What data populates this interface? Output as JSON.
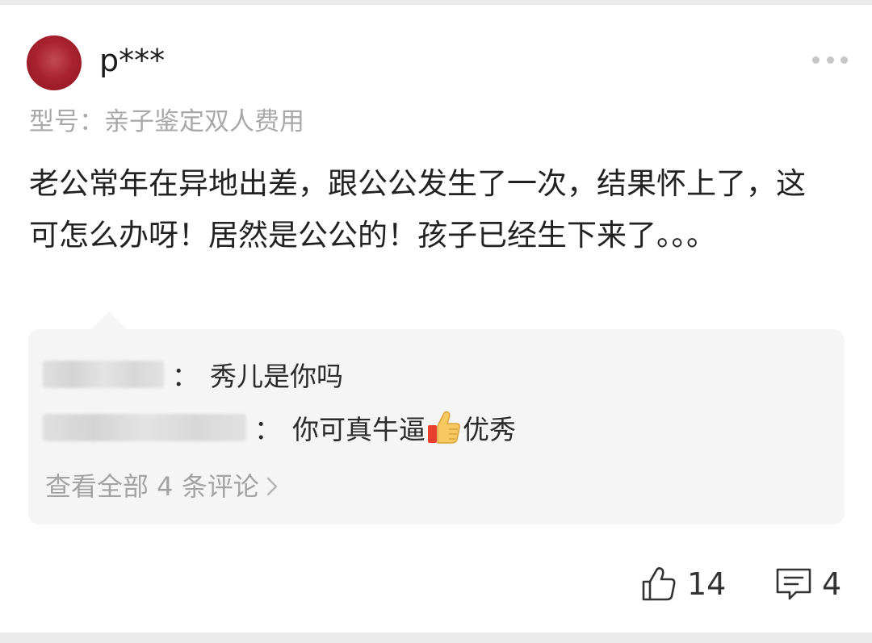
{
  "review": {
    "username": "p***",
    "avatar_color": "#a8232f",
    "model_label": "型号：",
    "model_value": "亲子鉴定双人费用",
    "content_parts": {
      "before_emoji_none": "老公常年在异地出差，跟公公发生了一次，结果怀上了，这可怎么办呀！居然是公公的！孩子已经生下来了。。。"
    }
  },
  "replies": [
    {
      "name_blurred": true,
      "colon": "：",
      "text": "秀儿是你吗"
    },
    {
      "name_blurred": true,
      "colon": "：",
      "text_before_emoji": "你可真牛逼",
      "emoji": "thumbs-up-emoji",
      "text_after_emoji": "优秀"
    }
  ],
  "view_all": "查看全部 4 条评论",
  "stats": {
    "likes": "14",
    "comments": "4"
  },
  "icons": {
    "more": "more-dots-icon",
    "like": "thumbs-up-icon",
    "comment": "comment-icon",
    "chevron": "chevron-right-icon"
  }
}
